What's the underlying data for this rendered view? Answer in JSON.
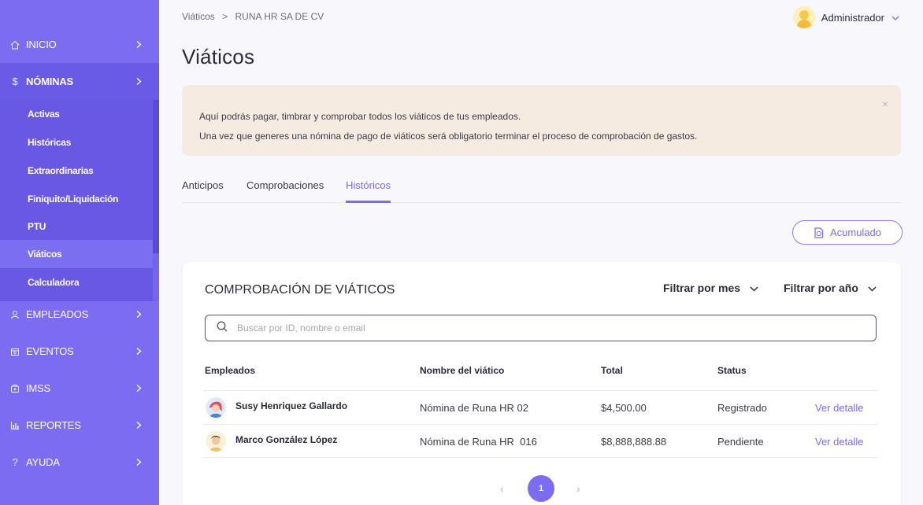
{
  "sidebar": {
    "items": [
      {
        "label": "INICIO",
        "icon": "home-icon"
      },
      {
        "label": "NÓMINAS",
        "icon": "dollar-icon"
      },
      {
        "label": "EMPLEADOS",
        "icon": "user-icon"
      },
      {
        "label": "EVENTOS",
        "icon": "calendar-icon"
      },
      {
        "label": "IMSS",
        "icon": "hospital-icon"
      },
      {
        "label": "REPORTES",
        "icon": "chart-icon"
      },
      {
        "label": "AYUDA",
        "icon": "help-icon"
      }
    ],
    "subitems": [
      "Activas",
      "Históricas",
      "Extraordinarias",
      "Finiquito/Liquidación",
      "PTU",
      "Viáticos",
      "Calculadora"
    ],
    "active_subitem": "Viáticos"
  },
  "breadcrumb": {
    "root": "Viáticos",
    "separator": ">",
    "current": "RUNA HR SA DE CV"
  },
  "user": {
    "name": "Administrador"
  },
  "page": {
    "title": "Viáticos"
  },
  "alert": {
    "line1": "Aquí podrás pagar, timbrar y comprobar todos los viáticos de tus empleados.",
    "line2": "Una vez que generes una nómina de pago de viáticos será obligatorio terminar el proceso de comprobación de gastos.",
    "close": "×"
  },
  "tabs": [
    "Anticipos",
    "Comprobaciones",
    "Históricos"
  ],
  "active_tab": "Históricos",
  "actions": {
    "acumulado": "Acumulado"
  },
  "card": {
    "title": "COMPROBACIÓN DE VIÁTICOS",
    "filter_month": "Filtrar por mes",
    "filter_year": "Filtrar por año",
    "search_placeholder": "Buscar por ID, nombre o email"
  },
  "table": {
    "headers": [
      "Empleados",
      "Nombre del viático",
      "Total",
      "Status"
    ],
    "rows": [
      {
        "employee": "Susy Henriquez Gallardo",
        "viatico": "Nómina de Runa HR 02",
        "total": "$4,500.00",
        "status": "Registrado",
        "action": "Ver detalle"
      },
      {
        "employee": "Marco González López",
        "viatico": "Nómina de Runa HR  016",
        "total": "$8,888,888.88",
        "status": "Pendiente",
        "action": "Ver detalle"
      }
    ]
  },
  "pagination": {
    "prev": "‹",
    "current": "1",
    "next": "›"
  },
  "colors": {
    "primary": "#7b6cf2",
    "sidebar": "#7b6cf2",
    "alert_bg": "#f6ebe1"
  }
}
